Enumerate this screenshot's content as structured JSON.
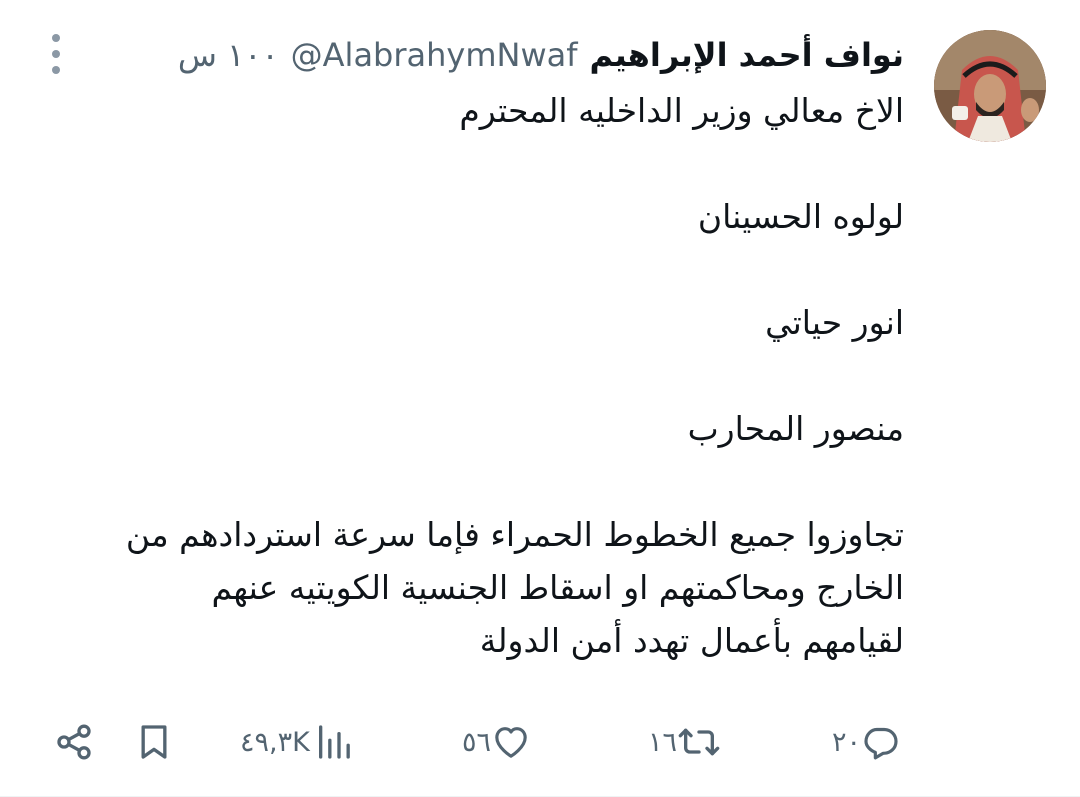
{
  "tweet": {
    "display_name": "نواف أحمد الإبراهيم",
    "handle": "@AlabrahymNwaf",
    "time": "١٠٠ س",
    "lines": [
      "الاخ معالي وزير الداخليه المحترم",
      "",
      "لولوه الحسينان",
      "",
      "انور حياتي",
      "",
      "منصور المحارب",
      "",
      "تجاوزوا جميع  الخطوط الحمراء فإما سرعة استردادهم من",
      "الخارج ومحاكمتهم او اسقاط الجنسية الكويتيه عنهم",
      "لقيامهم بأعمال تهدد أمن الدولة"
    ]
  },
  "actions": {
    "replies": "٢٠",
    "retweets": "١٦",
    "likes": "٥٦",
    "views": "٤٩,٣K"
  },
  "icons": {
    "more": "more-vertical-icon",
    "reply": "reply-icon",
    "retweet": "retweet-icon",
    "like": "heart-icon",
    "views": "views-bar-chart-icon",
    "bookmark": "bookmark-icon",
    "share": "share-icon"
  },
  "colors": {
    "text": "#0f1419",
    "secondary": "#536471"
  }
}
